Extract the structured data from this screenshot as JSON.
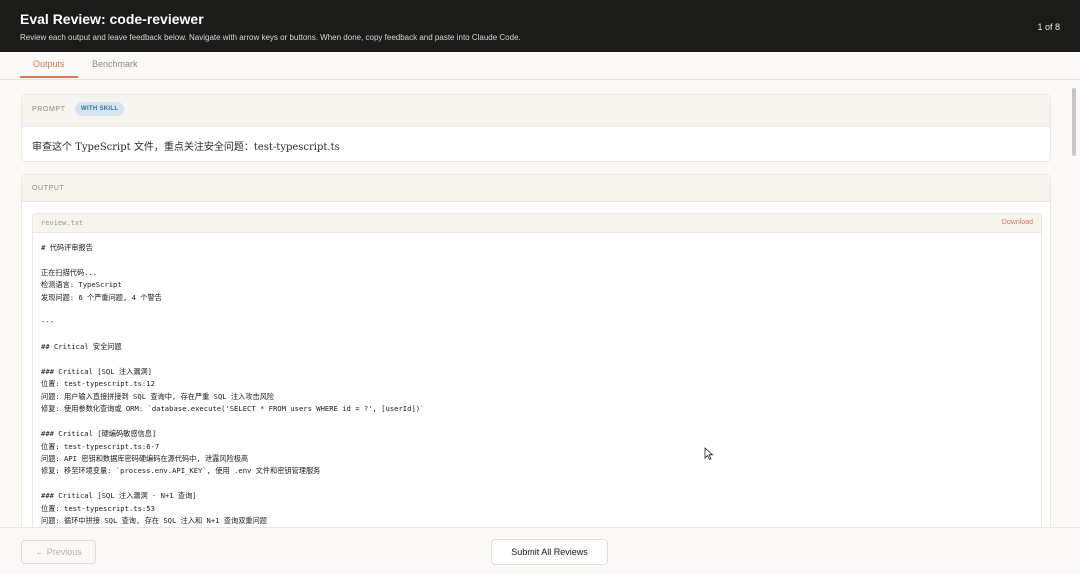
{
  "header": {
    "title": "Eval Review: code-reviewer",
    "subtitle": "Review each output and leave feedback below. Navigate with arrow keys or buttons. When done, copy feedback and paste into Claude Code.",
    "counter": "1 of 8"
  },
  "tabs": [
    {
      "label": "Outputs",
      "active": true
    },
    {
      "label": "Benchmark",
      "active": false
    }
  ],
  "prompt": {
    "section_label": "PROMPT",
    "badge": "WITH SKILL",
    "text": "审查这个 TypeScript 文件，重点关注安全问题：test-typescript.ts"
  },
  "output": {
    "section_label": "OUTPUT",
    "file_name": "review.txt",
    "download_label": "Download",
    "lines": [
      "# 代码评审报告",
      "",
      "正在扫描代码...",
      "检测语言: TypeScript",
      "发现问题: 6 个严重问题, 4 个警告",
      "",
      "---",
      "",
      "## Critical 安全问题",
      "",
      "### Critical [SQL 注入漏洞]",
      "位置: test-typescript.ts:12",
      "问题: 用户输入直接拼接到 SQL 查询中, 存在严重 SQL 注入攻击风险",
      "修复: 使用参数化查询或 ORM: `database.execute('SELECT * FROM users WHERE id = ?', [userId])`",
      "",
      "### Critical [硬编码敏感信息]",
      "位置: test-typescript.ts:6-7",
      "问题: API 密钥和数据库密码硬编码在源代码中, 泄露风险极高",
      "修复: 移至环境变量: `process.env.API_KEY`, 使用 .env 文件和密钥管理服务",
      "",
      "### Critical [SQL 注入漏洞 - N+1 查询]",
      "位置: test-typescript.ts:53",
      "问题: 循环中拼接 SQL 查询, 存在 SQL 注入和 N+1 查询双重问题"
    ]
  },
  "footer": {
    "previous_label": "← Previous",
    "submit_label": "Submit All Reviews"
  }
}
